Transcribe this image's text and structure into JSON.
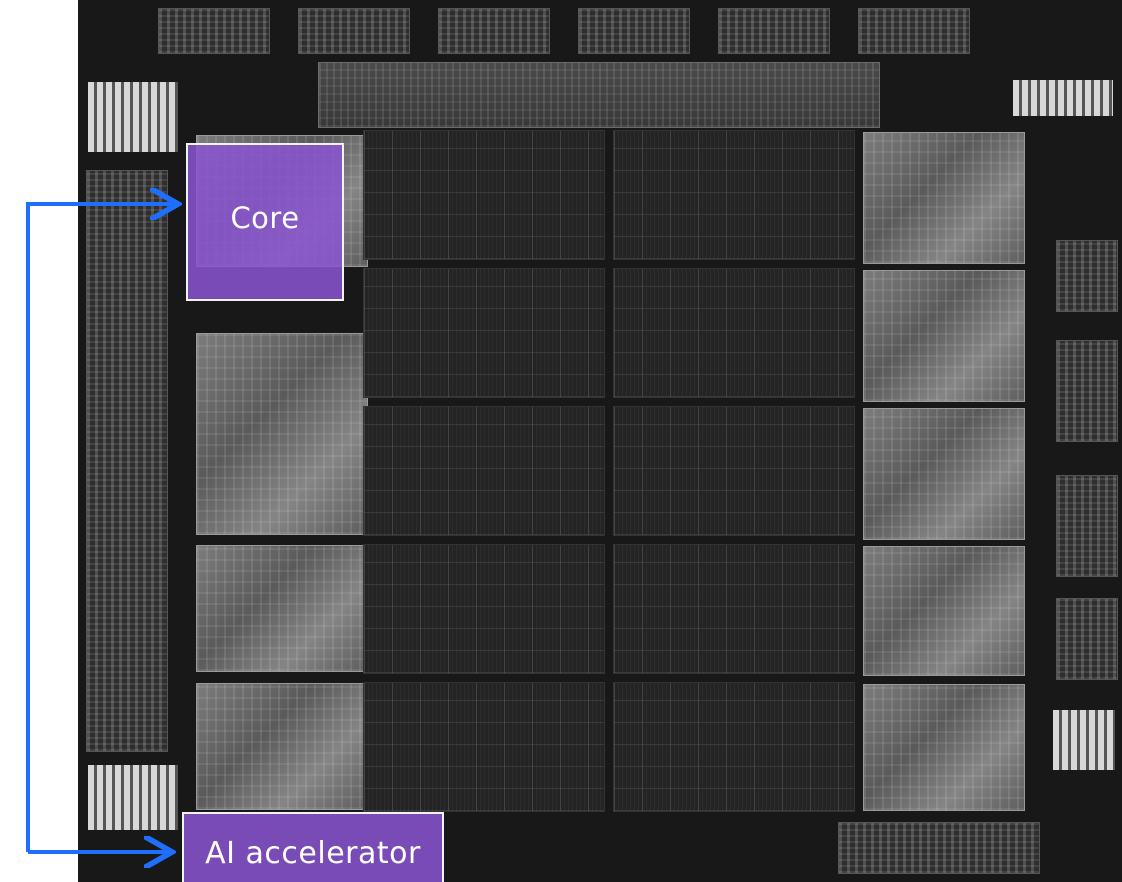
{
  "annotations": {
    "core_label": "Core",
    "ai_label": "AI accelerator"
  },
  "colors": {
    "label_fill": "#8854d2",
    "arrow": "#1f6fff",
    "die_background": "#181818"
  },
  "icons": [
    "arrow-to-core-icon",
    "arrow-to-ai-accelerator-icon"
  ]
}
